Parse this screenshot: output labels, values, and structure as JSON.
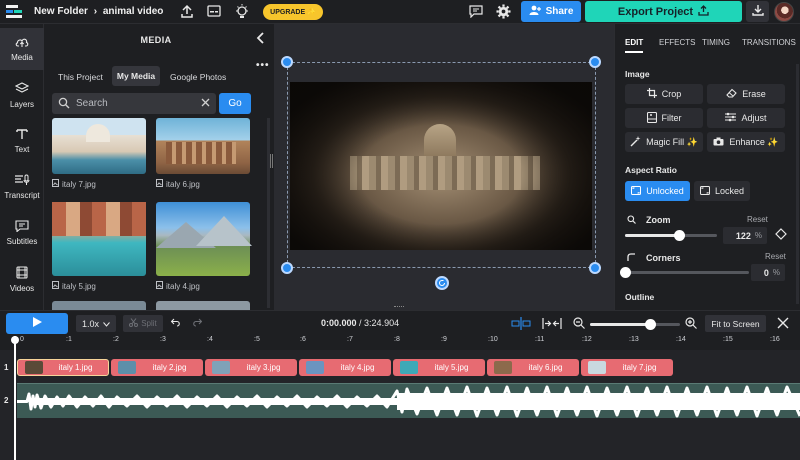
{
  "header": {
    "project": "New Folder",
    "separator": "›",
    "file": "animal video",
    "upgrade": "UPGRADE ✨",
    "share": "Share",
    "export": "Export Project"
  },
  "rail": [
    {
      "label": "Media",
      "icon": "cloud-upload-icon"
    },
    {
      "label": "Layers",
      "icon": "layers-icon"
    },
    {
      "label": "Text",
      "icon": "text-icon"
    },
    {
      "label": "Transcript",
      "icon": "transcript-icon"
    },
    {
      "label": "Subtitles",
      "icon": "subtitles-icon"
    },
    {
      "label": "Videos",
      "icon": "videos-icon"
    }
  ],
  "media": {
    "title": "MEDIA",
    "tabs": [
      "This Project",
      "My Media",
      "Google Photos"
    ],
    "active_tab": "My Media",
    "search_placeholder": "Search",
    "go": "Go",
    "files": [
      "italy 7.jpg",
      "italy 6.jpg",
      "italy 5.jpg",
      "italy 4.jpg"
    ]
  },
  "edit": {
    "tabs": [
      "EDIT",
      "EFFECTS",
      "TIMING",
      "TRANSITIONS"
    ],
    "image_heading": "Image",
    "tools": [
      "Crop",
      "Erase",
      "Filter",
      "Adjust",
      "Magic Fill ✨",
      "Enhance ✨"
    ],
    "aspect_heading": "Aspect Ratio",
    "unlocked": "Unlocked",
    "locked": "Locked",
    "zoom_label": "Zoom",
    "zoom_reset": "Reset",
    "zoom_value": "122",
    "zoom_unit": "%",
    "zoom_level": 0.59,
    "corners_label": "Corners",
    "corners_reset": "Reset",
    "corners_value": "0",
    "corners_unit": "%",
    "corners_level": 0,
    "outline_heading": "Outline"
  },
  "playback": {
    "speed": "1.0x",
    "split": "Split",
    "current_time": "0:00.000",
    "divider": " / ",
    "total_time": "3:24.904",
    "fit": "Fit to Screen",
    "zoom_level": 0.67
  },
  "ruler": [
    "0",
    ":1",
    ":2",
    ":3",
    ":4",
    ":5",
    ":6",
    ":7",
    ":8",
    ":9",
    ":10",
    ":11",
    ":12",
    ":13",
    ":14",
    ":15",
    ":16"
  ],
  "tracks": [
    "1",
    "2"
  ],
  "clips": [
    "italy 1.jpg",
    "italy 2.jpg",
    "italy 3.jpg",
    "italy 4.jpg",
    "italy 5.jpg",
    "italy 6.jpg",
    "italy 7.jpg"
  ],
  "colors": {
    "accent": "#2a8cf0",
    "export": "#1fd5b8",
    "upgrade": "#f7c52c",
    "clip": "#e76b72",
    "audio": "#3c5a55"
  }
}
